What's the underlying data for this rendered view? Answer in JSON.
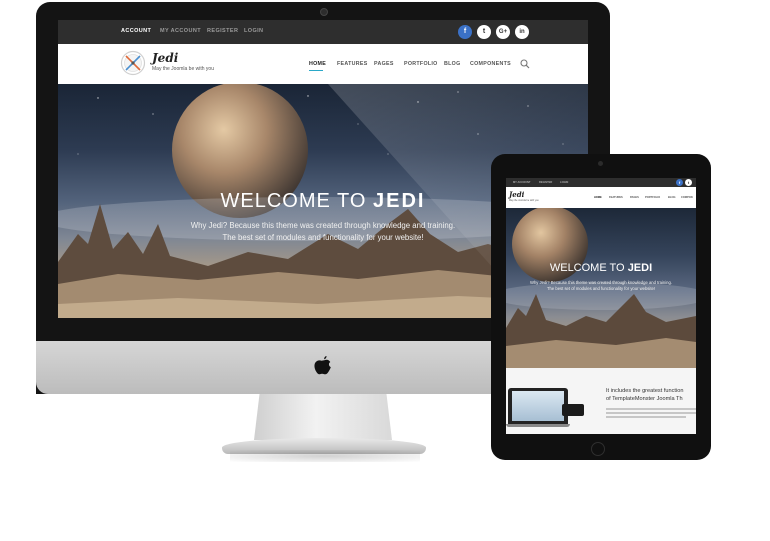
{
  "desktop": {
    "topbar": {
      "links": [
        "ACCOUNT",
        "MY ACCOUNT",
        "REGISTER",
        "LOGIN"
      ],
      "active_link": "ACCOUNT",
      "social": [
        "f",
        "t",
        "G+",
        "in"
      ]
    },
    "header": {
      "logo_name": "Jedi",
      "logo_tagline": "May the Joomla be with you",
      "nav": [
        "HOME",
        "FEATURES",
        "PAGES",
        "PORTFOLIO",
        "BLOG",
        "COMPONENTS"
      ],
      "active_nav": "HOME",
      "search_icon": "search-icon"
    },
    "hero": {
      "title_prefix": "WELCOME TO",
      "title_emphasis": "JEDI",
      "subtitle_line1": "Why Jedi? Because this theme was created through knowledge and training.",
      "subtitle_line2": "The best set of modules and functionality for your website!"
    }
  },
  "tablet": {
    "topbar": {
      "links": [
        "MY ACCOUNT",
        "REGISTER",
        "LOGIN"
      ],
      "social": [
        "f",
        "t"
      ]
    },
    "header": {
      "logo_name": "Jedi",
      "logo_tagline": "May the Joomla be with you",
      "nav": [
        "HOME",
        "FEATURES",
        "PAGES",
        "PORTFOLIO",
        "BLOG",
        "COMPON"
      ]
    },
    "hero": {
      "title_prefix": "WELCOME TO",
      "title_emphasis": "JEDI",
      "subtitle_line1": "Why Jedi? Because this theme was created through knowledge and training.",
      "subtitle_line2": "The best set of modules and functionality for your website!"
    },
    "features": {
      "line1": "It includes the greatest function",
      "line2": "of TemplateMonster Joomla Th"
    }
  },
  "colors": {
    "accent": "#2aa8c8",
    "facebook": "#3b71c6",
    "topbar_bg": "#2e2e2e"
  }
}
